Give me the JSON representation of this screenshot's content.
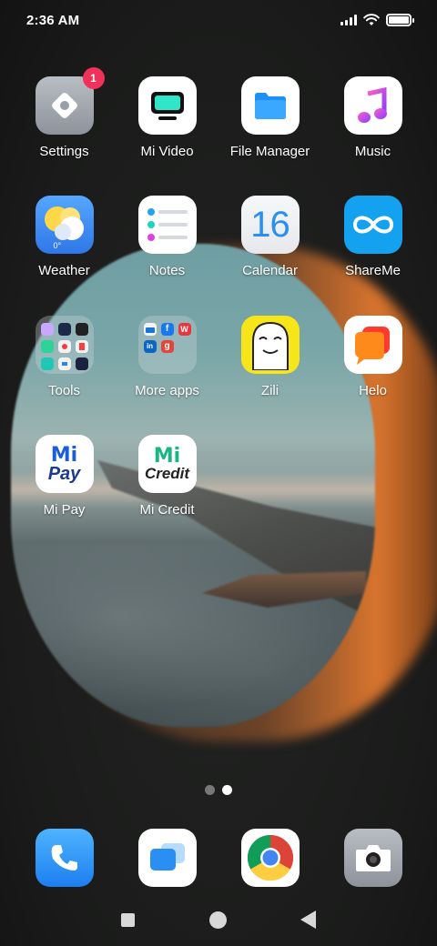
{
  "status_bar": {
    "time": "2:36 AM",
    "battery_level": 1.0
  },
  "apps": [
    {
      "key": "settings",
      "label": "Settings",
      "badge": "1",
      "icon": "gear-icon"
    },
    {
      "key": "mi-video",
      "label": "Mi Video",
      "icon": "tv-icon"
    },
    {
      "key": "file-manager",
      "label": "File Manager",
      "icon": "folder-icon"
    },
    {
      "key": "music",
      "label": "Music",
      "icon": "music-note-icon"
    },
    {
      "key": "weather",
      "label": "Weather",
      "icon": "weather-icon",
      "temp_text": "0°"
    },
    {
      "key": "notes",
      "label": "Notes",
      "icon": "notes-icon"
    },
    {
      "key": "calendar",
      "label": "Calendar",
      "icon": "calendar-icon",
      "day_number": "16"
    },
    {
      "key": "shareme",
      "label": "ShareMe",
      "icon": "infinity-icon"
    },
    {
      "key": "tools",
      "label": "Tools",
      "icon": "folder-tools-icon"
    },
    {
      "key": "more-apps",
      "label": "More apps",
      "icon": "folder-apps-icon"
    },
    {
      "key": "zili",
      "label": "Zili",
      "icon": "zili-face-icon"
    },
    {
      "key": "helo",
      "label": "Helo",
      "icon": "helo-icon"
    },
    {
      "key": "mi-pay",
      "label": "Mi Pay",
      "icon": "mi-pay-icon",
      "logo_top": "Mi",
      "logo_bottom": "Pay"
    },
    {
      "key": "mi-credit",
      "label": "Mi Credit",
      "icon": "mi-credit-icon",
      "logo_top": "Mi",
      "logo_bottom": "Credit"
    }
  ],
  "more_apps_folder": {
    "mini_letters": [
      "f",
      "W",
      "in",
      "g"
    ]
  },
  "page_indicator": {
    "pages": 2,
    "current": 2
  },
  "dock": [
    {
      "key": "phone",
      "icon": "phone-icon"
    },
    {
      "key": "messaging",
      "icon": "message-icon"
    },
    {
      "key": "chrome",
      "icon": "chrome-icon"
    },
    {
      "key": "camera",
      "icon": "camera-icon"
    }
  ],
  "colors": {
    "badge": "#f0325a",
    "file_manager": "#1e8ff5",
    "shareme": "#14a2f0",
    "weather": "#3a8bf0",
    "zili": "#f6e619",
    "helo": "#ff6a2a",
    "mi_green": "#18b680",
    "mi_blue": "#1a5fd8"
  }
}
